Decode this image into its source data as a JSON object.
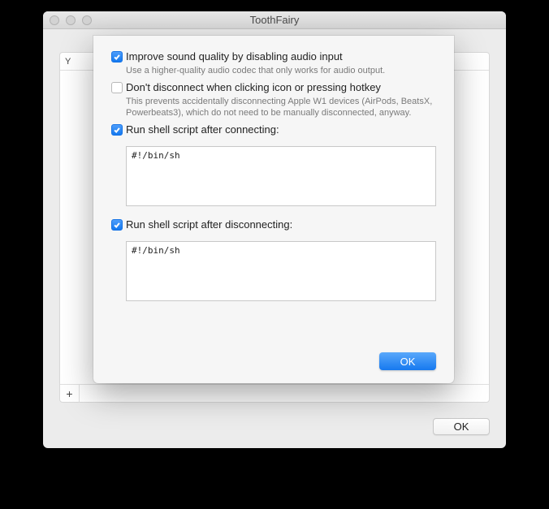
{
  "window": {
    "title": "ToothFairy",
    "column_header": "Y",
    "add_button_glyph": "+",
    "ok_label": "OK"
  },
  "sheet": {
    "options": {
      "improve_audio": {
        "checked": true,
        "label": "Improve sound quality by disabling audio input",
        "desc": "Use a higher-quality audio codec that only works for audio output."
      },
      "dont_disconnect": {
        "checked": false,
        "label": "Don't disconnect when clicking icon or pressing hotkey",
        "desc": "This prevents accidentally disconnecting Apple W1 devices (AirPods, BeatsX, Powerbeats3), which do not need to be manually disconnected, anyway."
      },
      "script_connect": {
        "checked": true,
        "label": "Run shell script after connecting:",
        "value": "#!/bin/sh"
      },
      "script_disconnect": {
        "checked": true,
        "label": "Run shell script after disconnecting:",
        "value": "#!/bin/sh"
      }
    },
    "ok_label": "OK"
  }
}
